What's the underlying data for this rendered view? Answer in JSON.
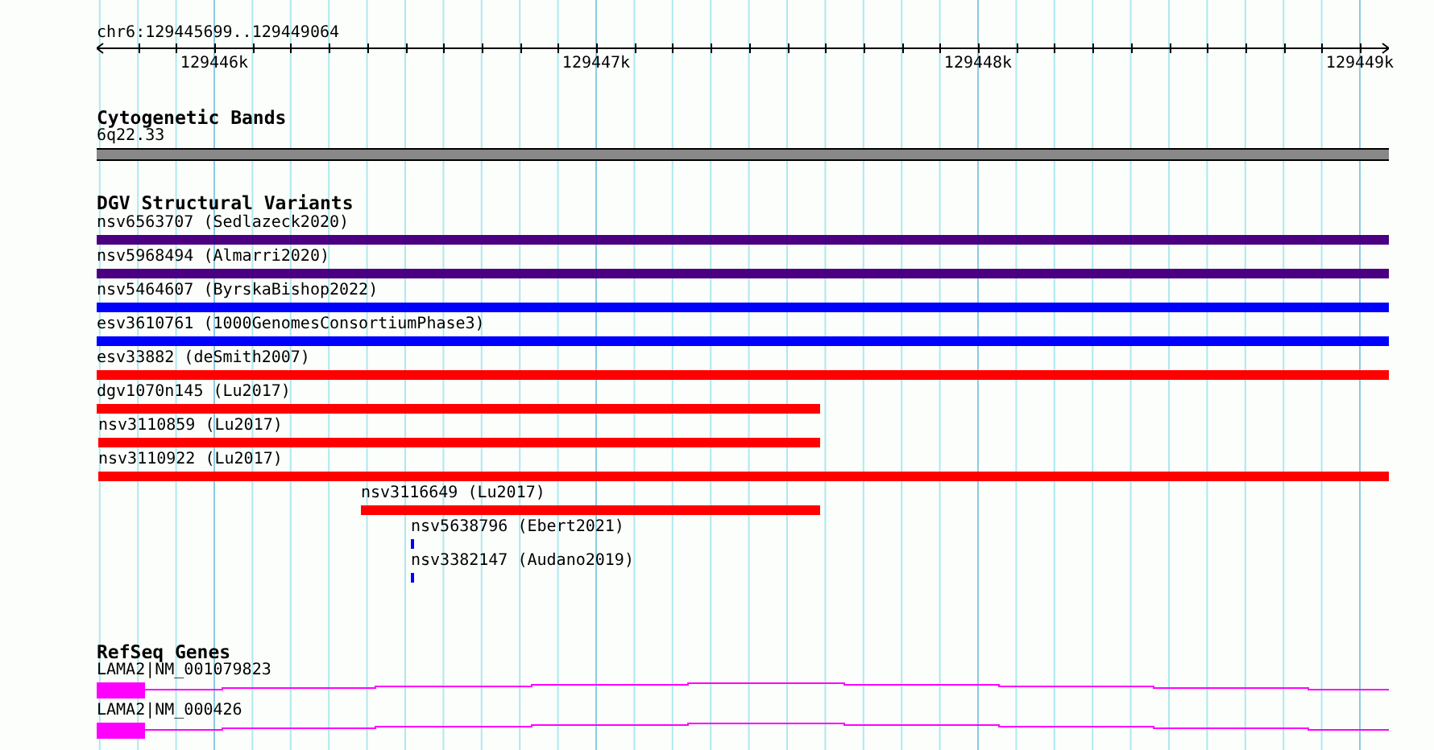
{
  "ruler": {
    "location": "chr6:129445699..129449064",
    "ticks": [
      "129446k",
      "129447k",
      "129448k",
      "129449k"
    ]
  },
  "tracks": [
    {
      "kind": "cytoband",
      "title": "Cytogenetic Bands",
      "features": [
        {
          "label": "6q22.33"
        }
      ]
    },
    {
      "kind": "variants",
      "title": "DGV Structural Variants",
      "features": [
        {
          "label": "nsv6563707 (Sedlazeck2020)",
          "color": "#4b0082"
        },
        {
          "label": "nsv5968494 (Almarri2020)",
          "color": "#4b0082"
        },
        {
          "label": "nsv5464607 (ByrskaBishop2022)",
          "color": "#0000ff"
        },
        {
          "label": "esv3610761 (1000GenomesConsortiumPhase3)",
          "color": "#0000ff"
        },
        {
          "label": "esv33882 (deSmith2007)",
          "color": "#ff0000"
        },
        {
          "label": "dgv1070n145 (Lu2017)",
          "color": "#ff0000"
        },
        {
          "label": "nsv3110859 (Lu2017)",
          "color": "#ff0000"
        },
        {
          "label": "nsv3110922 (Lu2017)",
          "color": "#ff0000"
        },
        {
          "label": "nsv3116649 (Lu2017)",
          "color": "#ff0000"
        },
        {
          "label": "nsv5638796 (Ebert2021)",
          "color": "#0000ff"
        },
        {
          "label": "nsv3382147 (Audano2019)",
          "color": "#0000ff"
        }
      ]
    },
    {
      "kind": "genes",
      "title": "RefSeq Genes",
      "features": [
        {
          "label": "LAMA2|NM_001079823"
        },
        {
          "label": "LAMA2|NM_000426"
        }
      ]
    }
  ]
}
